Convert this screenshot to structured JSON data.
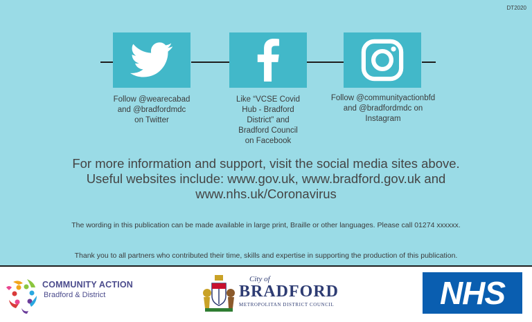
{
  "code": "DT2020",
  "colors": {
    "panel_bg": "#9adbe6",
    "social_box": "#42b8c9",
    "nhs_blue": "#0a5eb0",
    "bradford_navy": "#2e3c73",
    "community_action_purple": "#4b4b8c"
  },
  "social": [
    {
      "icon": "twitter-icon",
      "caption": "Follow @wearecabad\nand @bradfordmdc\non Twitter"
    },
    {
      "icon": "facebook-icon",
      "caption": "Like “VCSE Covid\nHub - Bradford\nDistrict” and\nBradford Council\non Facebook"
    },
    {
      "icon": "instagram-icon",
      "caption": "Follow @communityactionbfd\nand @bradfordmdc on\nInstagram"
    }
  ],
  "info_text": "For more information and support, visit the social media sites above.\nUseful websites include: www.gov.uk, www.bradford.gov.uk and\nwww.nhs.uk/Coronavirus",
  "notes": {
    "accessibility": "The wording in this publication can be made available in large print, Braille or other languages. Please call 01274 xxxxxx.",
    "thanks": "Thank you to all partners who contributed their time, skills and expertise in supporting the production of this publication."
  },
  "logos": {
    "community_action": {
      "line1": "COMMUNITY ACTION",
      "line2": "Bradford & District"
    },
    "bradford": {
      "city_of": "City of",
      "name": "BRADFORD",
      "subtitle": "METROPOLITAN DISTRICT COUNCIL"
    },
    "nhs": {
      "text": "NHS"
    }
  }
}
